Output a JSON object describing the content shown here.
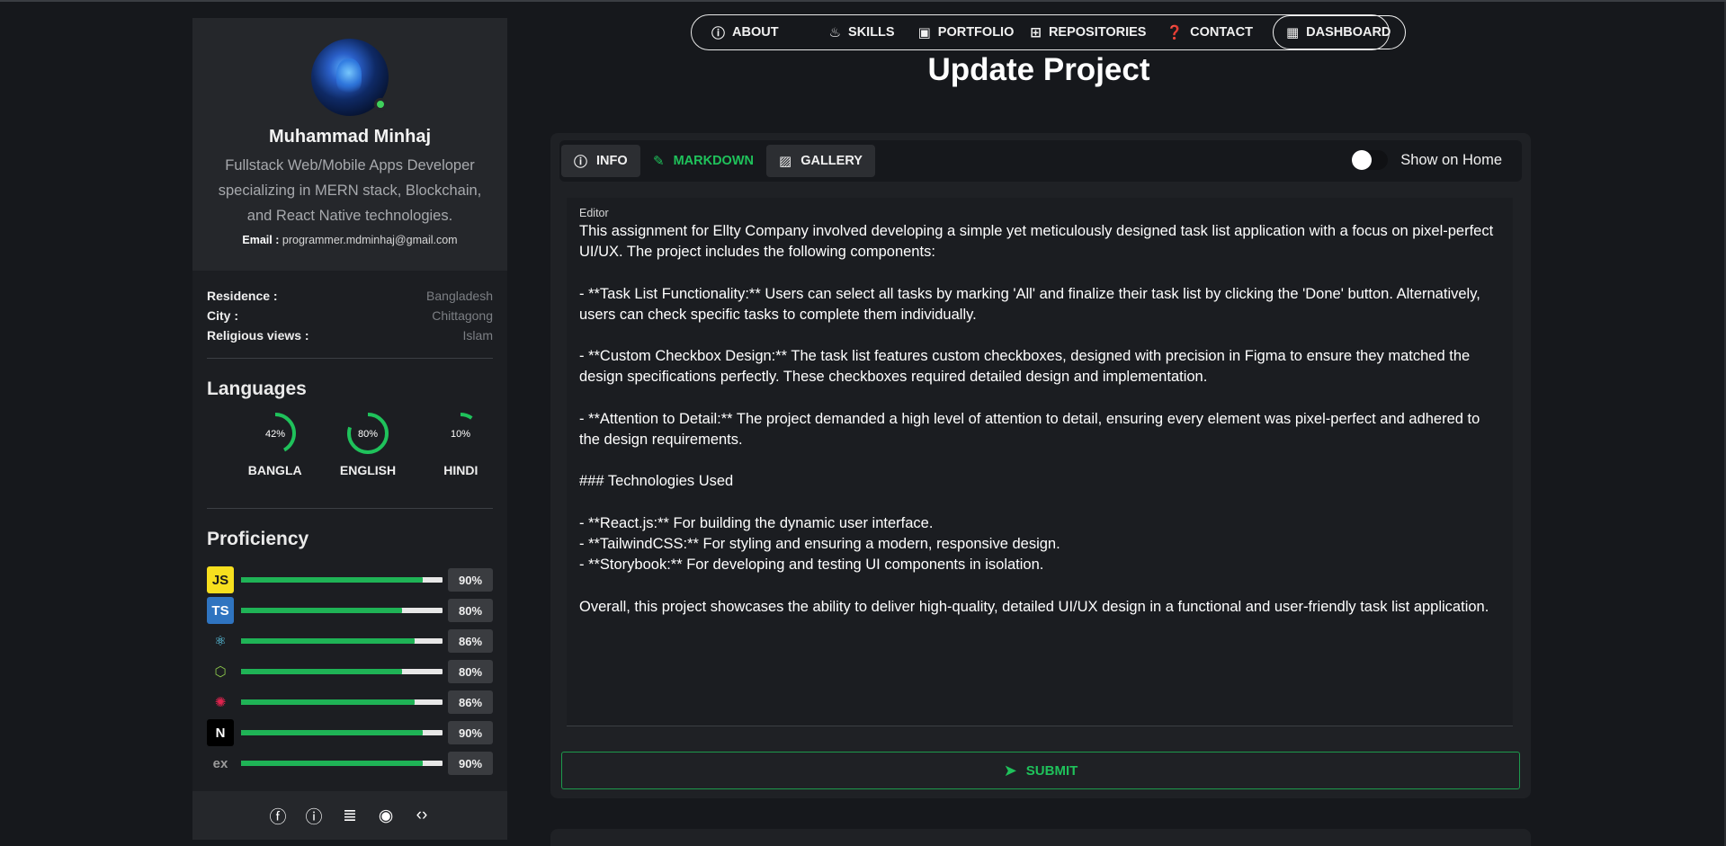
{
  "profile": {
    "name": "Muhammad Minhaj",
    "bio": "Fullstack Web/Mobile Apps Developer specializing in MERN stack, Blockchain, and React Native technologies.",
    "email_label": "Email :",
    "email": "programmer.mdminhaj@gmail.com",
    "status": "online"
  },
  "info": [
    {
      "key": "Residence :",
      "value": "Bangladesh"
    },
    {
      "key": "City :",
      "value": "Chittagong"
    },
    {
      "key": "Religious views :",
      "value": "Islam"
    }
  ],
  "languages": {
    "title": "Languages",
    "items": [
      {
        "name": "BANGLA",
        "percent": 42,
        "label": "42%"
      },
      {
        "name": "ENGLISH",
        "percent": 80,
        "label": "80%"
      },
      {
        "name": "HINDI",
        "percent": 10,
        "label": "10%"
      }
    ]
  },
  "proficiency": {
    "title": "Proficiency",
    "items": [
      {
        "icon": "javascript-icon",
        "glyph": "JS",
        "bg": "#f7df1e",
        "fg": "#1a1a1a",
        "percent": 90,
        "label": "90%"
      },
      {
        "icon": "typescript-icon",
        "glyph": "TS",
        "bg": "#2f74c0",
        "fg": "#ffffff",
        "percent": 80,
        "label": "80%"
      },
      {
        "icon": "react-icon",
        "glyph": "⚛",
        "bg": "transparent",
        "fg": "#61dafb",
        "percent": 86,
        "label": "86%"
      },
      {
        "icon": "nodejs-icon",
        "glyph": "⬡",
        "bg": "transparent",
        "fg": "#8cc84b",
        "percent": 80,
        "label": "80%"
      },
      {
        "icon": "nestjs-icon",
        "glyph": "✺",
        "bg": "transparent",
        "fg": "#e0234e",
        "percent": 86,
        "label": "86%"
      },
      {
        "icon": "nextjs-icon",
        "glyph": "N",
        "bg": "#000000",
        "fg": "#ffffff",
        "percent": 90,
        "label": "90%"
      },
      {
        "icon": "express-icon",
        "glyph": "ex",
        "bg": "transparent",
        "fg": "#9a9a9a",
        "percent": 90,
        "label": "90%"
      }
    ]
  },
  "social": [
    "facebook-icon",
    "linkedin-icon",
    "stackoverflow-icon",
    "github-icon",
    "code-icon"
  ],
  "nav": {
    "about": "ABOUT",
    "skills": "SKILLS",
    "portfolio": "PORTFOLIO",
    "repositories": "REPOSITORIES",
    "contact": "CONTACT",
    "dashboard": "DASHBOARD"
  },
  "page": {
    "title": "Update Project"
  },
  "tabs": {
    "info": "INFO",
    "markdown": "MARKDOWN",
    "gallery": "GALLERY",
    "active": "MARKDOWN"
  },
  "toggle": {
    "label": "Show on Home",
    "on": false
  },
  "editor": {
    "label": "Editor",
    "content": "This assignment for Ellty Company involved developing a simple yet meticulously designed task list application with a focus on pixel-perfect UI/UX. The project includes the following components:\n\n- **Task List Functionality:** Users can select all tasks by marking 'All' and finalize their task list by clicking the 'Done' button. Alternatively, users can check specific tasks to complete them individually.\n\n- **Custom Checkbox Design:** The task list features custom checkboxes, designed with precision in Figma to ensure they matched the design specifications perfectly. These checkboxes required detailed design and implementation.\n\n- **Attention to Detail:** The project demanded a high level of attention to detail, ensuring every element was pixel-perfect and adhered to the design requirements.\n\n### Technologies Used\n\n- **React.js:** For building the dynamic user interface.\n- **TailwindCSS:** For styling and ensuring a modern, responsive design.\n- **Storybook:** For developing and testing UI components in isolation.\n\nOverall, this project showcases the ability to deliver high-quality, detailed UI/UX design in a functional and user-friendly task list application."
  },
  "submit": {
    "label": "SUBMIT"
  },
  "colors": {
    "accent": "#1fc25b",
    "bar_track": "#e7e7e7",
    "bar_fill": "#1fb356",
    "panel": "#1f2125",
    "background": "#16181c"
  }
}
